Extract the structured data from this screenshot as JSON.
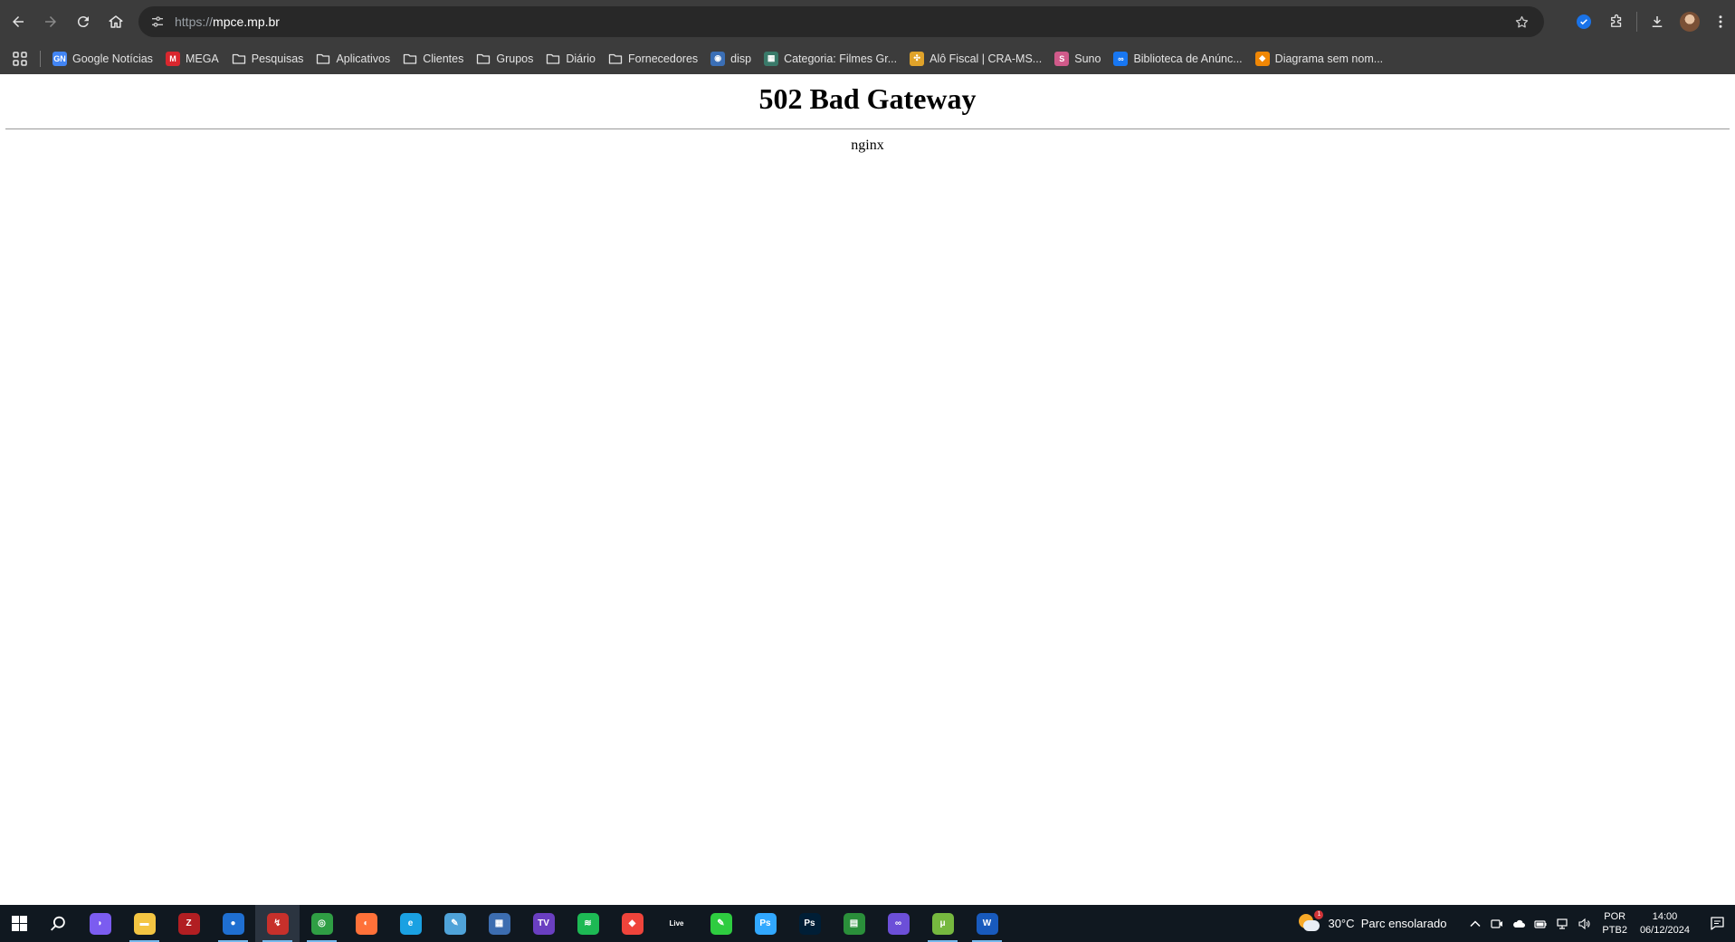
{
  "browser": {
    "url_scheme": "https://",
    "url_host": "mpce.mp.br",
    "icons": {
      "back": "back-arrow-icon",
      "forward": "forward-arrow-icon",
      "reload": "reload-icon",
      "home": "home-icon",
      "site_info": "tune-icon",
      "bookmark_star": "star-icon",
      "extension": "shield-check-icon",
      "extensions": "puzzle-icon",
      "downloads": "download-icon",
      "menu": "kebab-menu-icon"
    }
  },
  "bookmarks": [
    {
      "label": "Google Notícias",
      "icon": "google-news-icon",
      "color": "#4285f4",
      "glyph": "GN"
    },
    {
      "label": "MEGA",
      "icon": "mega-icon",
      "color": "#d9272e",
      "glyph": "M"
    },
    {
      "label": "Pesquisas",
      "icon": "folder-icon"
    },
    {
      "label": "Aplicativos",
      "icon": "folder-icon"
    },
    {
      "label": "Clientes",
      "icon": "folder-icon"
    },
    {
      "label": "Grupos",
      "icon": "folder-icon"
    },
    {
      "label": "Diário",
      "icon": "folder-icon"
    },
    {
      "label": "Fornecedores",
      "icon": "folder-icon"
    },
    {
      "label": "disp",
      "icon": "globe-icon",
      "color": "#3b6fb6",
      "glyph": "◉"
    },
    {
      "label": "Categoria: Filmes Gr...",
      "icon": "wiki-icon",
      "color": "#3a7a6a",
      "glyph": "▦"
    },
    {
      "label": "Alô Fiscal | CRA-MS...",
      "icon": "joomla-icon",
      "color": "#e0a32a",
      "glyph": "✣"
    },
    {
      "label": "Suno",
      "icon": "suno-icon",
      "color": "#d05a8a",
      "glyph": "S"
    },
    {
      "label": "Biblioteca de Anúnc...",
      "icon": "meta-icon",
      "color": "#1877f2",
      "glyph": "∞"
    },
    {
      "label": "Diagrama sem nom...",
      "icon": "drawio-icon",
      "color": "#f08705",
      "glyph": "◆"
    }
  ],
  "page": {
    "title": "502 Bad Gateway",
    "server": "nginx"
  },
  "taskbar": {
    "apps": [
      {
        "name": "copilot-icon",
        "color": "#7b5cf0",
        "glyph": "◗",
        "running": false
      },
      {
        "name": "file-explorer-icon",
        "color": "#f4c542",
        "glyph": "▬",
        "running": true
      },
      {
        "name": "filezilla-icon",
        "color": "#b11e22",
        "glyph": "Z",
        "running": false
      },
      {
        "name": "thunderbird-icon",
        "color": "#1f6fd1",
        "glyph": "●",
        "running": true
      },
      {
        "name": "tool-icon",
        "color": "#c7302b",
        "glyph": "↯",
        "running": true,
        "active": true
      },
      {
        "name": "chrome-icon",
        "color": "#2f9e44",
        "glyph": "◎",
        "running": true
      },
      {
        "name": "firefox-icon",
        "color": "#ff7139",
        "glyph": "◐",
        "running": false
      },
      {
        "name": "edge-icon",
        "color": "#1aa1e2",
        "glyph": "e",
        "running": false
      },
      {
        "name": "notepad-icon",
        "color": "#4fa3d9",
        "glyph": "✎",
        "running": false
      },
      {
        "name": "calculator-icon",
        "color": "#3c6db0",
        "glyph": "▦",
        "running": false
      },
      {
        "name": "iptv-icon",
        "color": "#6a3fc1",
        "glyph": "TV",
        "running": false
      },
      {
        "name": "spotify-icon",
        "color": "#1db954",
        "glyph": "≋",
        "running": false
      },
      {
        "name": "anydesk-icon",
        "color": "#ef443b",
        "glyph": "◆",
        "running": false
      },
      {
        "name": "live-icon",
        "color": "#101820",
        "glyph": "Live",
        "running": false
      },
      {
        "name": "notepadpp-icon",
        "color": "#2ecc40",
        "glyph": "✎",
        "running": false
      },
      {
        "name": "photoshop-icon",
        "color": "#31a8ff",
        "glyph": "Ps",
        "running": false
      },
      {
        "name": "photoshop-alt-icon",
        "color": "#001e36",
        "glyph": "Ps",
        "running": false
      },
      {
        "name": "sheet-icon",
        "color": "#2a8f3a",
        "glyph": "▤",
        "running": false
      },
      {
        "name": "vs-icon",
        "color": "#6c4fd8",
        "glyph": "∞",
        "running": false
      },
      {
        "name": "utorrent-icon",
        "color": "#76b83f",
        "glyph": "μ",
        "running": true
      },
      {
        "name": "word-icon",
        "color": "#185abd",
        "glyph": "W",
        "running": true
      }
    ],
    "weather": {
      "temp": "30°C",
      "desc": "Parc ensolarado",
      "alert": "1"
    },
    "language": {
      "line1": "POR",
      "line2": "PTB2"
    },
    "clock": {
      "time": "14:00",
      "date": "06/12/2024"
    }
  }
}
